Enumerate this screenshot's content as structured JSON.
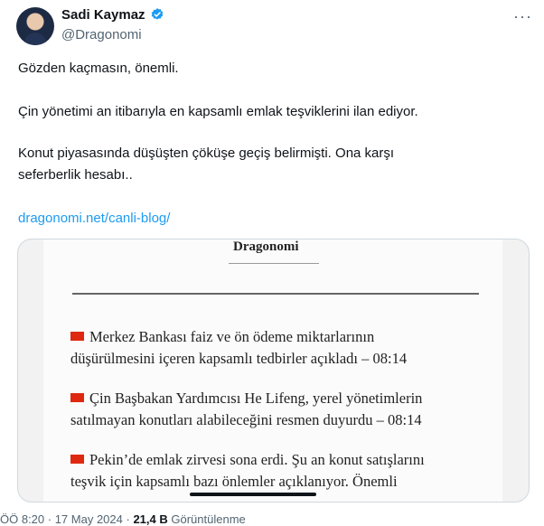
{
  "author": {
    "name": "Sadi Kaymaz",
    "handle": "@Dragonomi"
  },
  "tweet": {
    "lines": [
      "Gözden kaçmasın, önemli.",
      "Çin yönetimi an itibarıyla en kapsamlı emlak teşviklerini ilan ediyor.",
      "Konut piyasasında düşüşten çöküşe geçiş belirmişti. Ona karşı",
      "seferberlik hesabı.."
    ],
    "link": "dragonomi.net/canli-blog/"
  },
  "card": {
    "brand": "Dragonomi",
    "items": [
      [
        "Merkez Bankası faiz ve ön ödeme miktarlarının",
        "düşürülmesini içeren kapsamlı tedbirler açıkladı – 08:14"
      ],
      [
        "Çin Başbakan Yardımcısı He Lifeng, yerel yönetimlerin",
        "satılmayan konutları alabileceğini resmen duyurdu – 08:14"
      ],
      [
        "Pekin’de emlak zirvesi sona erdi. Şu an konut satışlarını",
        "teşvik için kapsamlı bazı önlemler açıklanıyor. Önemli"
      ]
    ]
  },
  "footer": {
    "time": "ÖÖ 8:20",
    "date": "17 May 2024",
    "views_count": "21,4 B",
    "views_label": "Görüntülenme"
  },
  "colors": {
    "link": "#1d9bf0",
    "verified": "#1d9bf0",
    "flag": "#de2910"
  }
}
